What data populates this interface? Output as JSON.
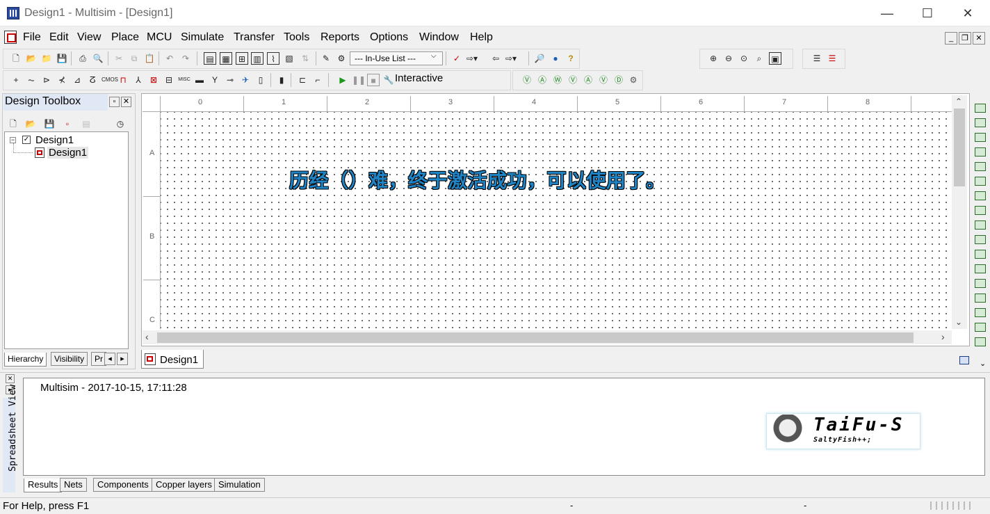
{
  "window": {
    "title": "Design1 - Multisim - [Design1]",
    "minimize": "—",
    "maximize": "☐",
    "close": "✕"
  },
  "menu": [
    "File",
    "Edit",
    "View",
    "Place",
    "MCU",
    "Simulate",
    "Transfer",
    "Tools",
    "Reports",
    "Options",
    "Window",
    "Help"
  ],
  "toolbar": {
    "inuse_list": "--- In-Use List ---",
    "interactive_label": "Interactive"
  },
  "toolbox": {
    "title": "Design Toolbox",
    "tree": {
      "root": "Design1",
      "child": "Design1"
    },
    "tabs": [
      "Hierarchy",
      "Visibility",
      "Pr"
    ]
  },
  "canvas": {
    "ruler_top": [
      "0",
      "1",
      "2",
      "3",
      "4",
      "5",
      "6",
      "7",
      "8"
    ],
    "ruler_left": [
      "A",
      "B",
      "C"
    ],
    "overlay_text": "历经（）难，终于激活成功，可以使用了。",
    "tab": "Design1"
  },
  "spreadsheet": {
    "side_label": "Spreadsheet View",
    "result_line": "Multisim  -  2017-10-15, 17:11:28",
    "tabs": [
      "Results",
      "Nets",
      "Components",
      "Copper layers",
      "Simulation"
    ]
  },
  "watermark": {
    "title": "TaiFu-S",
    "subtitle": "SaltyFish++;"
  },
  "status": {
    "help_text": "For Help, press F1",
    "dash1": "-",
    "dash2": "-"
  }
}
